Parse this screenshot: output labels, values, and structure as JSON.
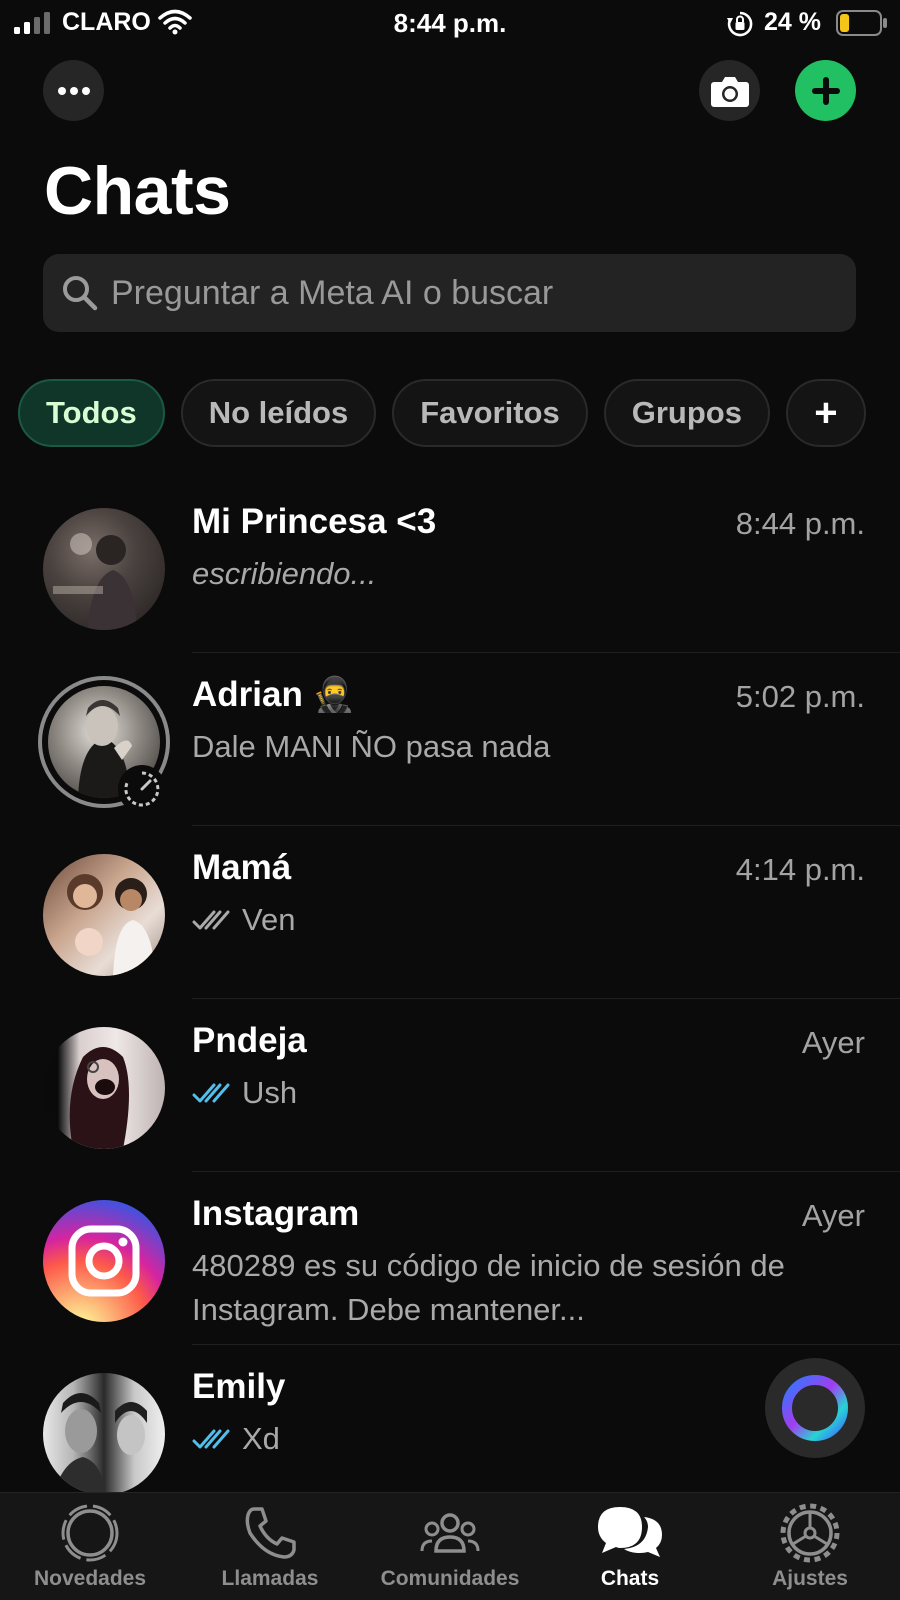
{
  "status_bar": {
    "carrier": "CLARO",
    "time": "8:44 p.m.",
    "battery": "24 %",
    "battery_level": 0.24
  },
  "header": {
    "title": "Chats",
    "icons": [
      "more-icon",
      "camera-icon",
      "plus-icon"
    ]
  },
  "search": {
    "placeholder": "Preguntar a Meta AI o buscar"
  },
  "filters": [
    {
      "label": "Todos",
      "active": true
    },
    {
      "label": "No leídos",
      "active": false
    },
    {
      "label": "Favoritos",
      "active": false
    },
    {
      "label": "Grupos",
      "active": false
    },
    {
      "label": "+",
      "active": false
    }
  ],
  "chats": [
    {
      "name": "Mi Princesa <3",
      "time": "8:44 p.m.",
      "message": "escribiendo...",
      "status": "typing"
    },
    {
      "name": "Adrian",
      "emoji": "🥷",
      "time": "5:02 p.m.",
      "message": "Dale MANI ÑO pasa nada",
      "status": "none"
    },
    {
      "name": "Mamá",
      "time": "4:14 p.m.",
      "message": "Ven",
      "status": "delivered"
    },
    {
      "name": "Pndeja",
      "time": "Ayer",
      "message": "Ush",
      "status": "read"
    },
    {
      "name": "Instagram",
      "time": "Ayer",
      "message": "480289 es su código de inicio de sesión de Instagram. Debe mantener...",
      "status": "none"
    },
    {
      "name": "Emily",
      "time": "",
      "message": "Xd",
      "status": "read"
    }
  ],
  "tabs": [
    {
      "label": "Novedades",
      "icon": "updates-icon",
      "active": false
    },
    {
      "label": "Llamadas",
      "icon": "phone-icon",
      "active": false
    },
    {
      "label": "Comunidades",
      "icon": "communities-icon",
      "active": false
    },
    {
      "label": "Chats",
      "icon": "chats-icon",
      "active": true
    },
    {
      "label": "Ajustes",
      "icon": "settings-icon",
      "active": false
    }
  ],
  "colors": {
    "accent": "#21c063",
    "read_ticks": "#53bdeb",
    "delivered_ticks": "#a9a9a9",
    "active_chip_bg": "#103629",
    "active_chip_text": "#d8fdd2",
    "background": "#0b0b0b"
  }
}
